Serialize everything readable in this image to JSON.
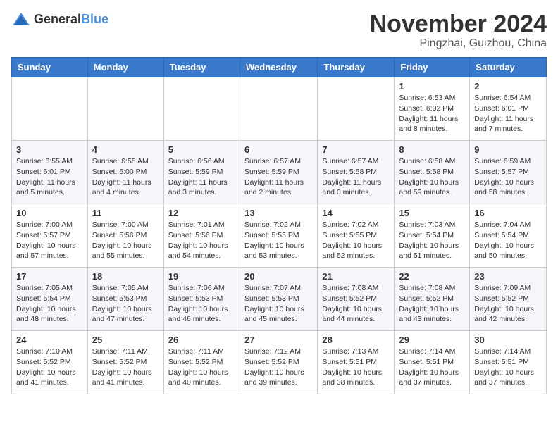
{
  "header": {
    "logo_general": "General",
    "logo_blue": "Blue",
    "month": "November 2024",
    "location": "Pingzhai, Guizhou, China"
  },
  "weekdays": [
    "Sunday",
    "Monday",
    "Tuesday",
    "Wednesday",
    "Thursday",
    "Friday",
    "Saturday"
  ],
  "weeks": [
    [
      {
        "day": "",
        "info": ""
      },
      {
        "day": "",
        "info": ""
      },
      {
        "day": "",
        "info": ""
      },
      {
        "day": "",
        "info": ""
      },
      {
        "day": "",
        "info": ""
      },
      {
        "day": "1",
        "info": "Sunrise: 6:53 AM\nSunset: 6:02 PM\nDaylight: 11 hours and 8 minutes."
      },
      {
        "day": "2",
        "info": "Sunrise: 6:54 AM\nSunset: 6:01 PM\nDaylight: 11 hours and 7 minutes."
      }
    ],
    [
      {
        "day": "3",
        "info": "Sunrise: 6:55 AM\nSunset: 6:01 PM\nDaylight: 11 hours and 5 minutes."
      },
      {
        "day": "4",
        "info": "Sunrise: 6:55 AM\nSunset: 6:00 PM\nDaylight: 11 hours and 4 minutes."
      },
      {
        "day": "5",
        "info": "Sunrise: 6:56 AM\nSunset: 5:59 PM\nDaylight: 11 hours and 3 minutes."
      },
      {
        "day": "6",
        "info": "Sunrise: 6:57 AM\nSunset: 5:59 PM\nDaylight: 11 hours and 2 minutes."
      },
      {
        "day": "7",
        "info": "Sunrise: 6:57 AM\nSunset: 5:58 PM\nDaylight: 11 hours and 0 minutes."
      },
      {
        "day": "8",
        "info": "Sunrise: 6:58 AM\nSunset: 5:58 PM\nDaylight: 10 hours and 59 minutes."
      },
      {
        "day": "9",
        "info": "Sunrise: 6:59 AM\nSunset: 5:57 PM\nDaylight: 10 hours and 58 minutes."
      }
    ],
    [
      {
        "day": "10",
        "info": "Sunrise: 7:00 AM\nSunset: 5:57 PM\nDaylight: 10 hours and 57 minutes."
      },
      {
        "day": "11",
        "info": "Sunrise: 7:00 AM\nSunset: 5:56 PM\nDaylight: 10 hours and 55 minutes."
      },
      {
        "day": "12",
        "info": "Sunrise: 7:01 AM\nSunset: 5:56 PM\nDaylight: 10 hours and 54 minutes."
      },
      {
        "day": "13",
        "info": "Sunrise: 7:02 AM\nSunset: 5:55 PM\nDaylight: 10 hours and 53 minutes."
      },
      {
        "day": "14",
        "info": "Sunrise: 7:02 AM\nSunset: 5:55 PM\nDaylight: 10 hours and 52 minutes."
      },
      {
        "day": "15",
        "info": "Sunrise: 7:03 AM\nSunset: 5:54 PM\nDaylight: 10 hours and 51 minutes."
      },
      {
        "day": "16",
        "info": "Sunrise: 7:04 AM\nSunset: 5:54 PM\nDaylight: 10 hours and 50 minutes."
      }
    ],
    [
      {
        "day": "17",
        "info": "Sunrise: 7:05 AM\nSunset: 5:54 PM\nDaylight: 10 hours and 48 minutes."
      },
      {
        "day": "18",
        "info": "Sunrise: 7:05 AM\nSunset: 5:53 PM\nDaylight: 10 hours and 47 minutes."
      },
      {
        "day": "19",
        "info": "Sunrise: 7:06 AM\nSunset: 5:53 PM\nDaylight: 10 hours and 46 minutes."
      },
      {
        "day": "20",
        "info": "Sunrise: 7:07 AM\nSunset: 5:53 PM\nDaylight: 10 hours and 45 minutes."
      },
      {
        "day": "21",
        "info": "Sunrise: 7:08 AM\nSunset: 5:52 PM\nDaylight: 10 hours and 44 minutes."
      },
      {
        "day": "22",
        "info": "Sunrise: 7:08 AM\nSunset: 5:52 PM\nDaylight: 10 hours and 43 minutes."
      },
      {
        "day": "23",
        "info": "Sunrise: 7:09 AM\nSunset: 5:52 PM\nDaylight: 10 hours and 42 minutes."
      }
    ],
    [
      {
        "day": "24",
        "info": "Sunrise: 7:10 AM\nSunset: 5:52 PM\nDaylight: 10 hours and 41 minutes."
      },
      {
        "day": "25",
        "info": "Sunrise: 7:11 AM\nSunset: 5:52 PM\nDaylight: 10 hours and 41 minutes."
      },
      {
        "day": "26",
        "info": "Sunrise: 7:11 AM\nSunset: 5:52 PM\nDaylight: 10 hours and 40 minutes."
      },
      {
        "day": "27",
        "info": "Sunrise: 7:12 AM\nSunset: 5:52 PM\nDaylight: 10 hours and 39 minutes."
      },
      {
        "day": "28",
        "info": "Sunrise: 7:13 AM\nSunset: 5:51 PM\nDaylight: 10 hours and 38 minutes."
      },
      {
        "day": "29",
        "info": "Sunrise: 7:14 AM\nSunset: 5:51 PM\nDaylight: 10 hours and 37 minutes."
      },
      {
        "day": "30",
        "info": "Sunrise: 7:14 AM\nSunset: 5:51 PM\nDaylight: 10 hours and 37 minutes."
      }
    ]
  ]
}
